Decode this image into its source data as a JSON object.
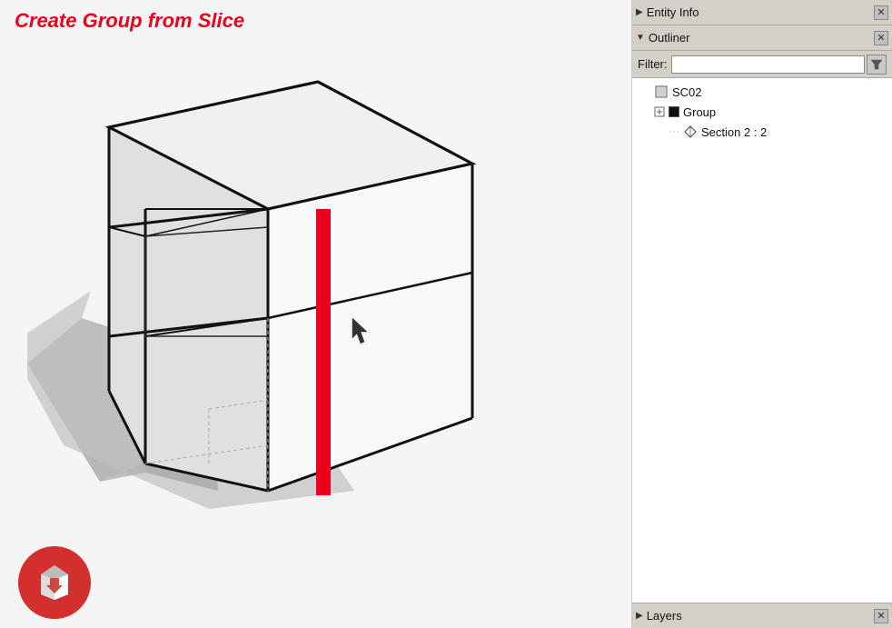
{
  "page": {
    "title": "Create Group from Slice",
    "title_color": "#e8001c"
  },
  "entity_info": {
    "label": "Entity Info",
    "arrow": "▶",
    "close": "✕"
  },
  "outliner": {
    "label": "Outliner",
    "arrow": "▼",
    "close": "✕",
    "filter_label": "Filter:",
    "filter_placeholder": "",
    "tree": [
      {
        "id": "sc02",
        "label": "SC02",
        "indent": 0,
        "type": "model",
        "expand": ""
      },
      {
        "id": "group",
        "label": "Group",
        "indent": 1,
        "type": "group",
        "expand": "⊞"
      },
      {
        "id": "section2",
        "label": "Section 2 : 2",
        "indent": 2,
        "type": "section",
        "expand": ""
      }
    ]
  },
  "layers": {
    "label": "Layers",
    "arrow": "▶",
    "close": "✕"
  },
  "colors": {
    "group_square": "#111111",
    "red_line": "#e8001c"
  }
}
